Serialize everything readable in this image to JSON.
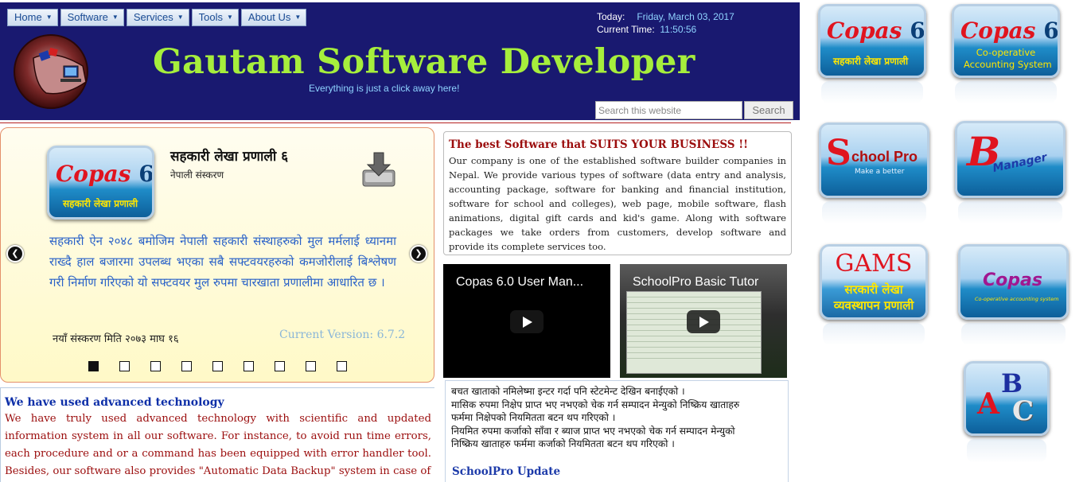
{
  "header": {
    "menu": [
      "Home",
      "Software",
      "Services",
      "Tools",
      "About Us"
    ],
    "title": "Gautam Software Developer",
    "tagline": "Everything is just a click away here!",
    "today_label": "Today:",
    "today_value": "Friday, March 03, 2017",
    "time_label": "Current Time:",
    "time_value": "11:50:56",
    "search_placeholder": "Search this website",
    "search_button": "Search",
    "logo_text": "Gautam Software Developer"
  },
  "slider": {
    "badge_word": "Copas",
    "badge_num": "6",
    "badge_sub": "सहकारी लेखा प्रणाली",
    "title": "सहकारी लेखा प्रणाली ६",
    "subtitle": "नेपाली संस्करण",
    "description": "सहकारी ऐन २०४८ बमोजिम नेपाली सहकारी संस्थाहरुको मुल मर्मलाई ध्यानमा राख्दै हाल बजारमा उपलब्ध भएका सबै सफ्टवयरहरुको कमजोरीलाई बिश्लेषण गरी निर्माण गरिएको यो सफ्टवयर मुल रुपमा चारखाता प्रणालीमा आधारित छ ।",
    "release_date": "नयाँ संस्करण मिति २०७३ माघ १६",
    "version": "Current Version: 6.7.2",
    "prev_icon": "chevron-left-icon",
    "next_icon": "chevron-right-icon",
    "page_count": 9,
    "active_page": 1
  },
  "about": {
    "heading": "The best Software that SUITS YOUR BUSINESS !!",
    "text": "Our company is one of the established software builder companies in Nepal. We provide various types of software (data entry and analysis, accounting package, software for banking and financial institution, software for school and colleges), web page, mobile software, flash animations, digital gift cards and kid's game. Along with software packages we take orders from customers, develop software and provide its complete services too."
  },
  "videos": [
    {
      "title": "Copas 6.0 User Man..."
    },
    {
      "title": "SchoolPro Basic Tutor"
    }
  ],
  "technology": {
    "heading": "We have used advanced technology",
    "text": "We have truly used advanced technology with scientific and updated information system in all our software. For instance, to avoid run time errors, each procedure and or a command has been equipped with error handler tool. Besides, our software also provides \"Automatic Data Backup\" system in case of"
  },
  "news": {
    "lines": [
      "बचत खाताको नमिलेष्मा इन्टर गर्दा पनि स्टेटमेन्ट देखिन बनाईएको ।",
      "मासिक रुपमा निक्षेप प्राप्त भए नभएको चेक गर्न सम्पादन मेन्युको निष्क्रिय खाताहरु",
      "फर्ममा निक्षेपको नियमितता बटन थप गरिएको ।",
      "नियमित रुपमा कर्जाको साँवा र ब्याज प्राप्त भए नभएको चेक गर्न सम्पादन मेन्युको",
      "निष्क्रिय खाताहरु फर्ममा कर्जाको नियमितता बटन थप गरिएको ।"
    ],
    "heading": "SchoolPro Update"
  },
  "sidebar": {
    "copas1_word": "Copas",
    "copas1_num": "6",
    "copas1_sub": "सहकारी लेखा प्रणाली",
    "copas2_word": "Copas",
    "copas2_num": "6",
    "copas2_sub1": "Co-operative",
    "copas2_sub2": "Accounting System",
    "schoolpro_s": "S",
    "schoolpro_text": "chool Pro",
    "schoolpro_sub": "Make a better",
    "bmanager_b": "B",
    "bmanager_text": "Manager",
    "gams_title": "GAMS",
    "gams_sub1": "सरकारी लेखा",
    "gams_sub2": "व्यवस्थापन प्रणाली",
    "copas3_text": "Copas",
    "copas3_sub": "Co-operative accounting system",
    "abc_a": "A",
    "abc_b": "B",
    "abc_c": "C"
  },
  "colors": {
    "header_bg": "#191970",
    "title_green": "#a6ee3c",
    "accent_red": "#9b0d0d",
    "link_blue": "#1c3aa9"
  }
}
